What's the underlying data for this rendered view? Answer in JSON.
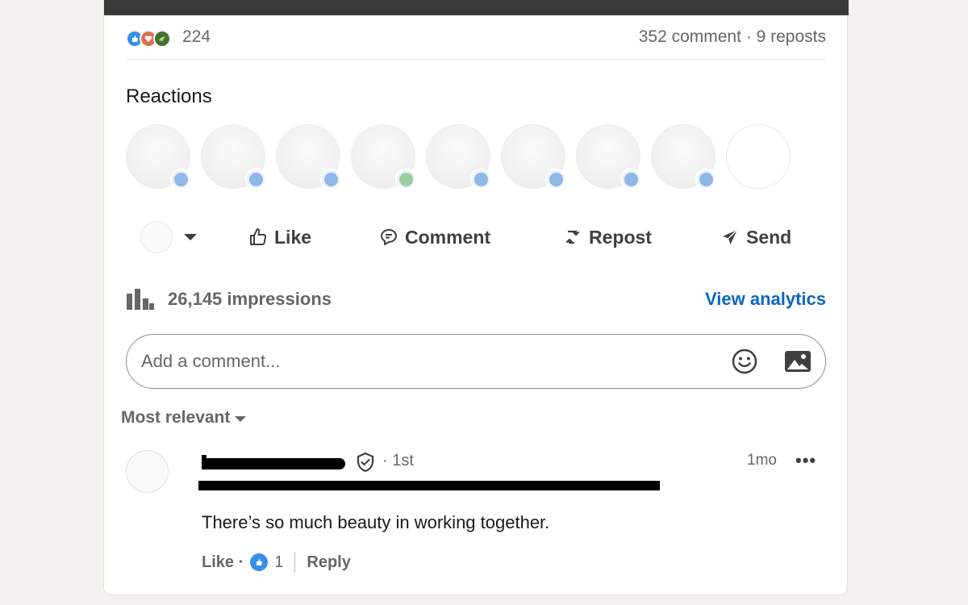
{
  "social_counts": {
    "reaction_count": "224",
    "comments_reposts": "352 comment · 9 reposts",
    "reaction_icons": [
      "like-icon",
      "love-icon",
      "support-icon"
    ]
  },
  "reactions_section": {
    "title": "Reactions"
  },
  "actions": {
    "like": "Like",
    "comment": "Comment",
    "repost": "Repost",
    "send": "Send"
  },
  "impressions": {
    "text": "26,145 impressions",
    "link": "View analytics"
  },
  "comment_box": {
    "placeholder": "Add a comment..."
  },
  "sort": {
    "label": "Most relevant"
  },
  "comment": {
    "degree": "· 1st",
    "time": "1mo",
    "more": "•••",
    "text": "There’s so much beauty in working together.",
    "like_label": "Like ·",
    "like_count": "1",
    "reply_label": "Reply"
  },
  "colors": {
    "accent": "#0a66c2",
    "like_blue": "#378fe9"
  }
}
